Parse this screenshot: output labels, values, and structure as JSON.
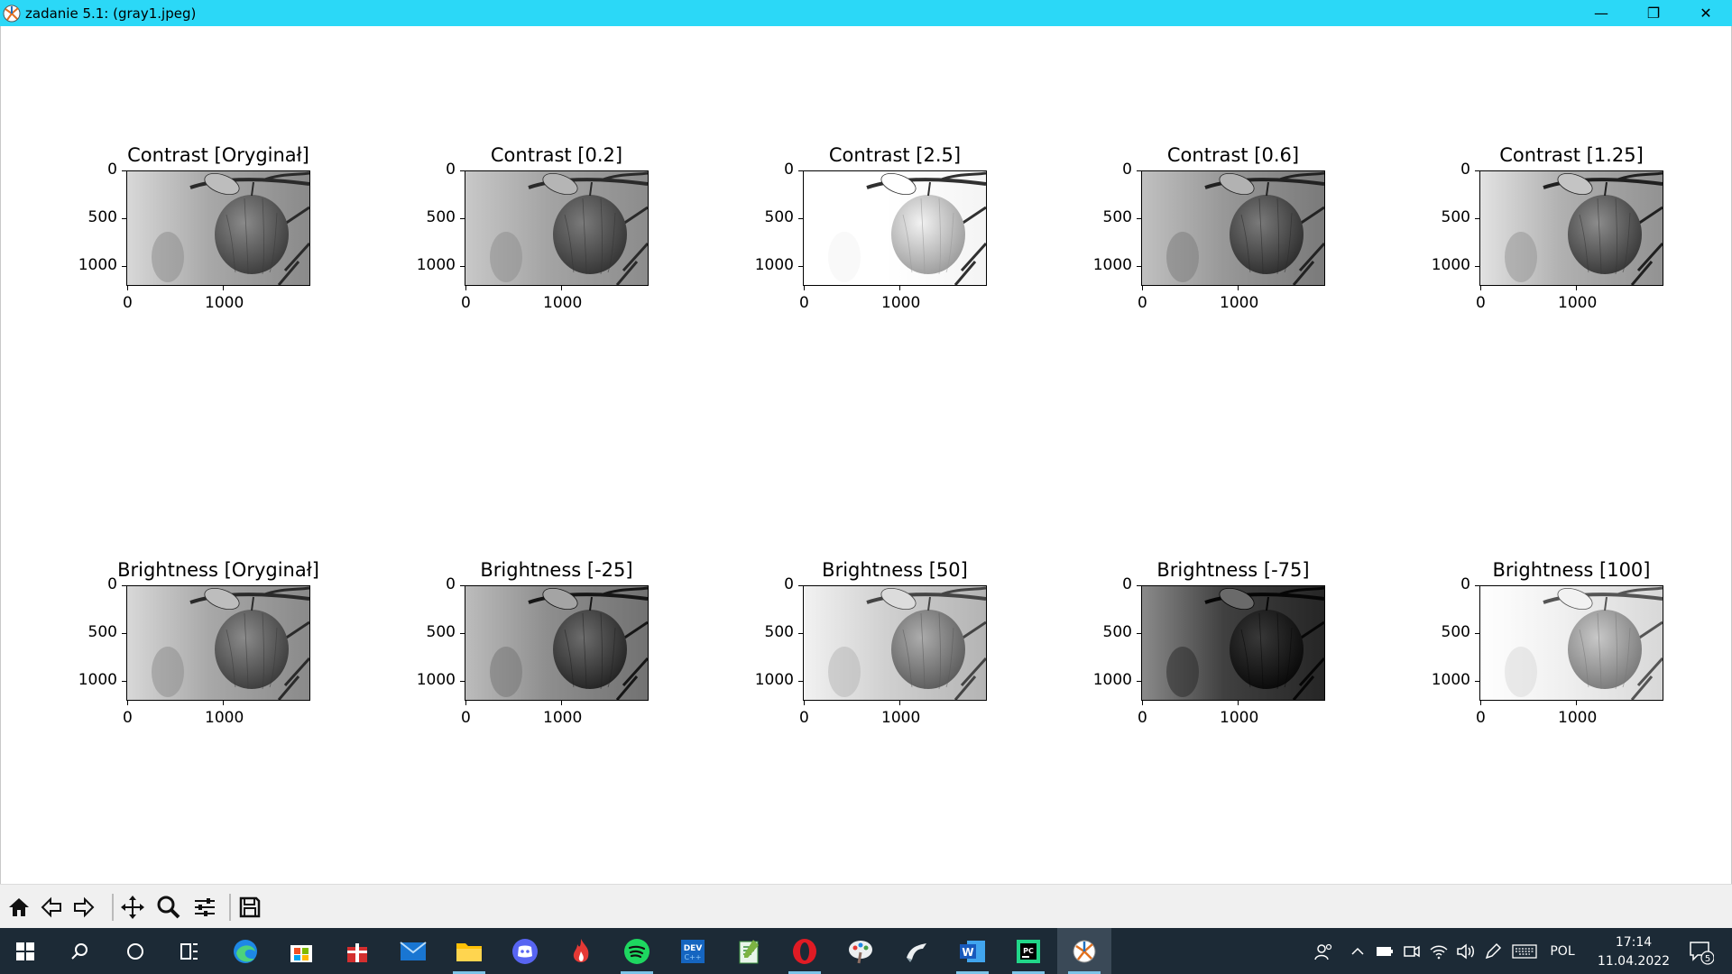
{
  "window": {
    "title": "zadanie 5.1: (gray1.jpeg)",
    "minimize": "—",
    "restore": "❐",
    "close": "✕"
  },
  "figure": {
    "panels": [
      {
        "title": "Contrast [Oryginał]",
        "variant": "orig"
      },
      {
        "title": "Contrast [0.2]",
        "variant": "c02"
      },
      {
        "title": "Contrast [2.5]",
        "variant": "c25"
      },
      {
        "title": "Contrast [0.6]",
        "variant": "c06"
      },
      {
        "title": "Contrast [1.25]",
        "variant": "c125"
      },
      {
        "title": "Brightness [Oryginał]",
        "variant": "orig"
      },
      {
        "title": "Brightness [-25]",
        "variant": "bm25"
      },
      {
        "title": "Brightness [50]",
        "variant": "b50"
      },
      {
        "title": "Brightness [-75]",
        "variant": "bm75"
      },
      {
        "title": "Brightness [100]",
        "variant": "b100"
      }
    ],
    "y_ticks": [
      "0",
      "500",
      "1000"
    ],
    "x_ticks": [
      "0",
      "1000"
    ]
  },
  "toolbar": {
    "buttons": [
      "home-icon",
      "back-icon",
      "forward-icon",
      "pan-icon",
      "zoom-icon",
      "configure-icon",
      "save-icon"
    ]
  },
  "taskbar": {
    "apps": [
      "start-icon",
      "search-icon",
      "cortana-icon",
      "task-view-icon",
      "edge-icon",
      "store-icon",
      "gift-icon",
      "mail-icon",
      "file-explorer-icon",
      "discord-icon",
      "flame-app-icon",
      "spotify-icon",
      "devcpp-icon",
      "notepadpp-icon",
      "opera-icon",
      "paint-icon",
      "arrow-app-icon",
      "word-icon",
      "pycharm-icon",
      "matplotlib-icon"
    ],
    "language": "POL",
    "time": "17:14",
    "date": "11.04.2022",
    "notifications": "5"
  }
}
